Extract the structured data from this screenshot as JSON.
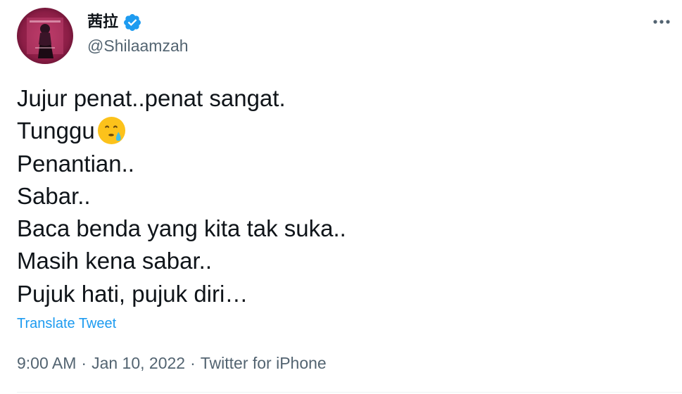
{
  "author": {
    "display_name": "茜拉",
    "handle": "@Shilaamzah",
    "verified": true,
    "avatar_icon": "profile-photo",
    "verified_icon": "verified-badge-icon"
  },
  "header": {
    "more_icon": "more-options-icon"
  },
  "tweet": {
    "lines": [
      "Jujur penat..penat sangat.",
      "Tunggu",
      "Penantian..",
      "Sabar..",
      "Baca benda yang kita tak suka..",
      "Masih kena sabar..",
      "Pujuk hati, pujuk diri…"
    ],
    "emoji_after_line_2": "face-holding-back-tears-icon"
  },
  "translate_label": "Translate Tweet",
  "meta": {
    "time": "9:00 AM",
    "separator": "·",
    "date": "Jan 10, 2022",
    "client": "Twitter for iPhone"
  },
  "colors": {
    "text_primary": "#0f1419",
    "text_secondary": "#536471",
    "link": "#1d9bf0",
    "verified_badge": "#1d9bf0",
    "emoji_face": "#fcc21b",
    "tear": "#40c0e7"
  }
}
